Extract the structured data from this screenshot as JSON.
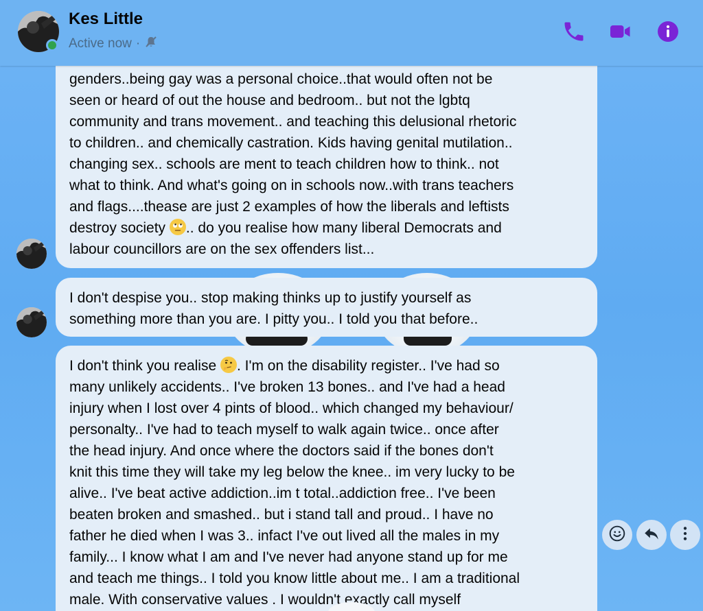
{
  "header": {
    "contact_name": "Kes Little",
    "status": "Active now",
    "separator": "·",
    "icons": [
      "phone-icon",
      "video-camera-icon",
      "info-icon",
      "muted-bell-icon"
    ]
  },
  "colors": {
    "accent": "#7a25d6",
    "bubble_bg": "#e4eef8",
    "background": "#65aff3",
    "presence": "#31a24c"
  },
  "messages": [
    {
      "lines": [
        "genders..being gay was a personal choice..that would often not be",
        "seen or heard of out the house and bedroom.. but not the lgbtq",
        "community and trans movement.. and teaching this delusional rhetoric",
        "to children.. and chemically castration. Kids having genital mutilation..",
        "changing sex.. schools are ment to teach children how to think.. not",
        "what to think. And what's going on in schools now..with trans teachers",
        "and flags....thease are just 2 examples of how the liberals and leftists"
      ],
      "emoji_line_before": "destroy society ",
      "emoji": "face-with-rolling-eyes",
      "emoji_line_after": ".. do you realise how many liberal Democrats and",
      "last_line": "labour councillors are on the sex offenders list..."
    },
    {
      "lines": [
        "I don't despise you.. stop making thinks up to justify yourself as",
        "something more than you are.  I pitty you.. I told you that before.."
      ]
    },
    {
      "first_before": "I don't think you realise ",
      "emoji": "thinking-face",
      "first_after": ". I'm on the disability register.. I've had so",
      "lines": [
        "many unlikely accidents.. I've broken 13 bones.. and I've had a head",
        "injury when I lost over 4 pints of blood.. which changed my behaviour/",
        "personalty.. I've had to teach myself to walk again twice.. once after",
        "the head injury. And once where the doctors said if the bones don't",
        "knit this time they will take my leg below the knee.. im very lucky to be",
        "alive.. I've beat active addiction..im t total..addiction free.. I've been",
        "beaten broken and smashed.. but i stand tall and proud.. I have no",
        "father he died when I was 3.. infact I've out lived all the males in my",
        "family... I know what I am and I've never had anyone stand up for me",
        "and teach me things.. I told you know little about me.. I am a traditional",
        "male.  With conservative values . I wouldn't exactly call myself"
      ]
    }
  ],
  "actions": [
    "react-icon",
    "reply-icon",
    "more-icon"
  ]
}
